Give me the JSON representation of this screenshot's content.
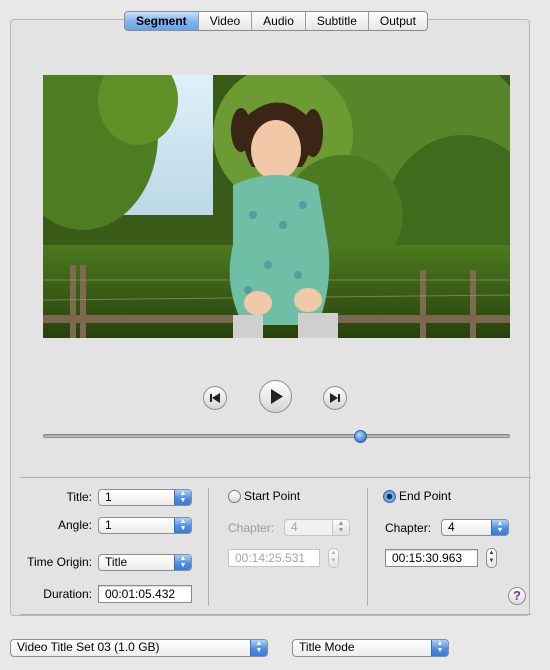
{
  "tabs": [
    "Segment",
    "Video",
    "Audio",
    "Subtitle",
    "Output"
  ],
  "active_tab": "Segment",
  "playback": {
    "position_fraction": 0.68
  },
  "left": {
    "title_label": "Title:",
    "title_value": "1",
    "angle_label": "Angle:",
    "angle_value": "1",
    "time_origin_label": "Time Origin:",
    "time_origin_value": "Title",
    "duration_label": "Duration:",
    "duration_value": "00:01:05.432"
  },
  "start": {
    "radio_label": "Start Point",
    "chapter_label": "Chapter:",
    "chapter_value": "4",
    "time_value": "00:14:25.531"
  },
  "end": {
    "radio_label": "End Point",
    "chapter_label": "Chapter:",
    "chapter_value": "4",
    "time_value": "00:15:30.963"
  },
  "help_label": "?",
  "bottom": {
    "title_set": "Video Title Set 03 (1.0 GB)",
    "mode": "Title Mode"
  },
  "colors": {
    "accent": "#4d8de3",
    "panel": "#e3e3e3"
  }
}
